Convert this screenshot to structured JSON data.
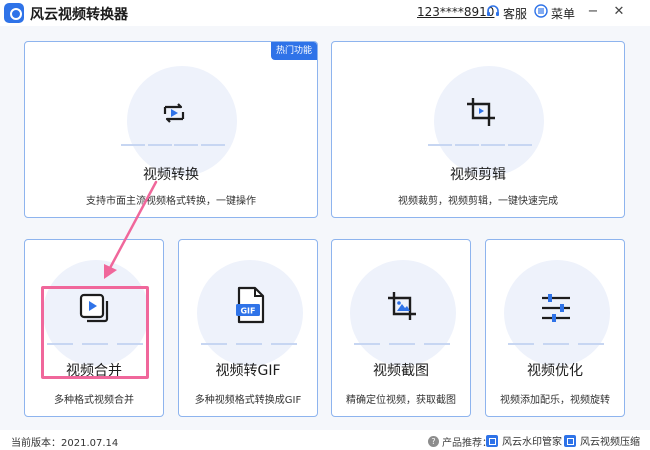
{
  "app": {
    "title": "风云视频转换器",
    "account": "123****8910",
    "support_label": "客服",
    "menu_label": "菜单",
    "minimize_glyph": "−",
    "close_glyph": "✕",
    "accent_color": "#2f73e8"
  },
  "cards": {
    "convert": {
      "title": "视频转换",
      "desc": "支持市面主流视频格式转换，一键操作",
      "badge": "热门功能",
      "icon": "play-loop-icon"
    },
    "edit": {
      "title": "视频剪辑",
      "desc": "视频裁剪，视频剪辑，一键快速完成",
      "icon": "crop-icon"
    },
    "merge": {
      "title": "视频合并",
      "desc": "多种格式视频合并",
      "icon": "stacked-play-icon"
    },
    "gif": {
      "title": "视频转GIF",
      "desc": "多种视频格式转换成GIF",
      "icon": "gif-file-icon",
      "icon_text": "GIF"
    },
    "screenshot": {
      "title": "视频截图",
      "desc": "精确定位视频，获取截图",
      "icon": "crop-image-icon"
    },
    "optimize": {
      "title": "视频优化",
      "desc": "视频添加配乐，视频旋转",
      "icon": "sliders-icon"
    }
  },
  "statusbar": {
    "version": "当前版本：2021.07.14",
    "recommend_label": "产品推荐：",
    "products": [
      "风云水印管家",
      "风云视频压缩"
    ]
  },
  "annotation": {
    "highlight_color": "#f0679b"
  }
}
